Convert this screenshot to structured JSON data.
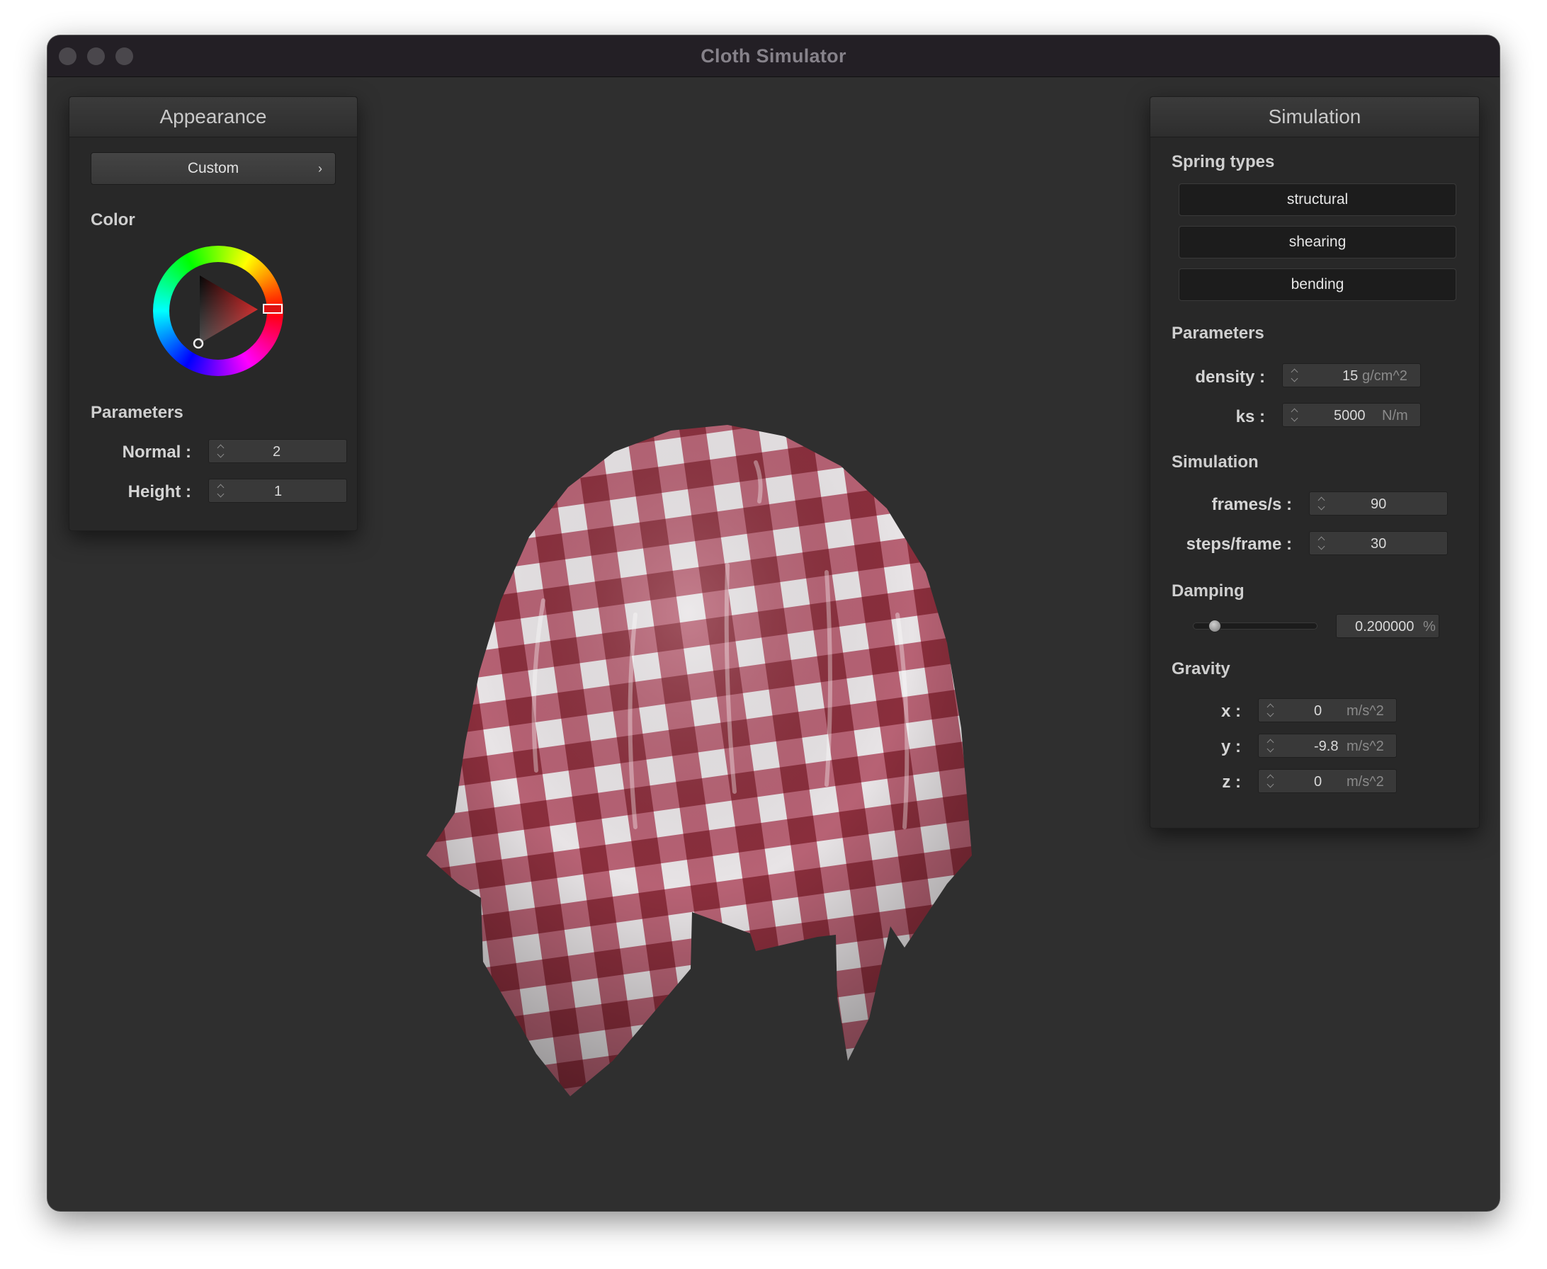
{
  "window": {
    "title": "Cloth Simulator"
  },
  "appearance": {
    "title": "Appearance",
    "preset": "Custom",
    "color_label": "Color",
    "color_value": "#cc1a1a",
    "parameters_label": "Parameters",
    "normal_label": "Normal :",
    "normal_value": "2",
    "height_label": "Height :",
    "height_value": "1"
  },
  "simulation": {
    "title": "Simulation",
    "spring_types_label": "Spring types",
    "springs": [
      "structural",
      "shearing",
      "bending"
    ],
    "parameters_label": "Parameters",
    "density_label": "density :",
    "density_value": "15",
    "density_unit": "g/cm^2",
    "ks_label": "ks :",
    "ks_value": "5000",
    "ks_unit": "N/m",
    "sim_label": "Simulation",
    "fps_label": "frames/s :",
    "fps_value": "90",
    "steps_label": "steps/frame :",
    "steps_value": "30",
    "damping_label": "Damping",
    "damping_value": "0.200000",
    "damping_unit": "%",
    "damping_level": 0.2,
    "gravity_label": "Gravity",
    "gx_label": "x :",
    "gx_value": "0",
    "gy_label": "y :",
    "gy_value": "-9.8",
    "gz_label": "z :",
    "gz_value": "0",
    "gravity_unit": "m/s^2"
  },
  "cloth_colors": {
    "dark": "#8a2e3c",
    "light": "#e8e4e6",
    "background": "#2f2f2f"
  }
}
